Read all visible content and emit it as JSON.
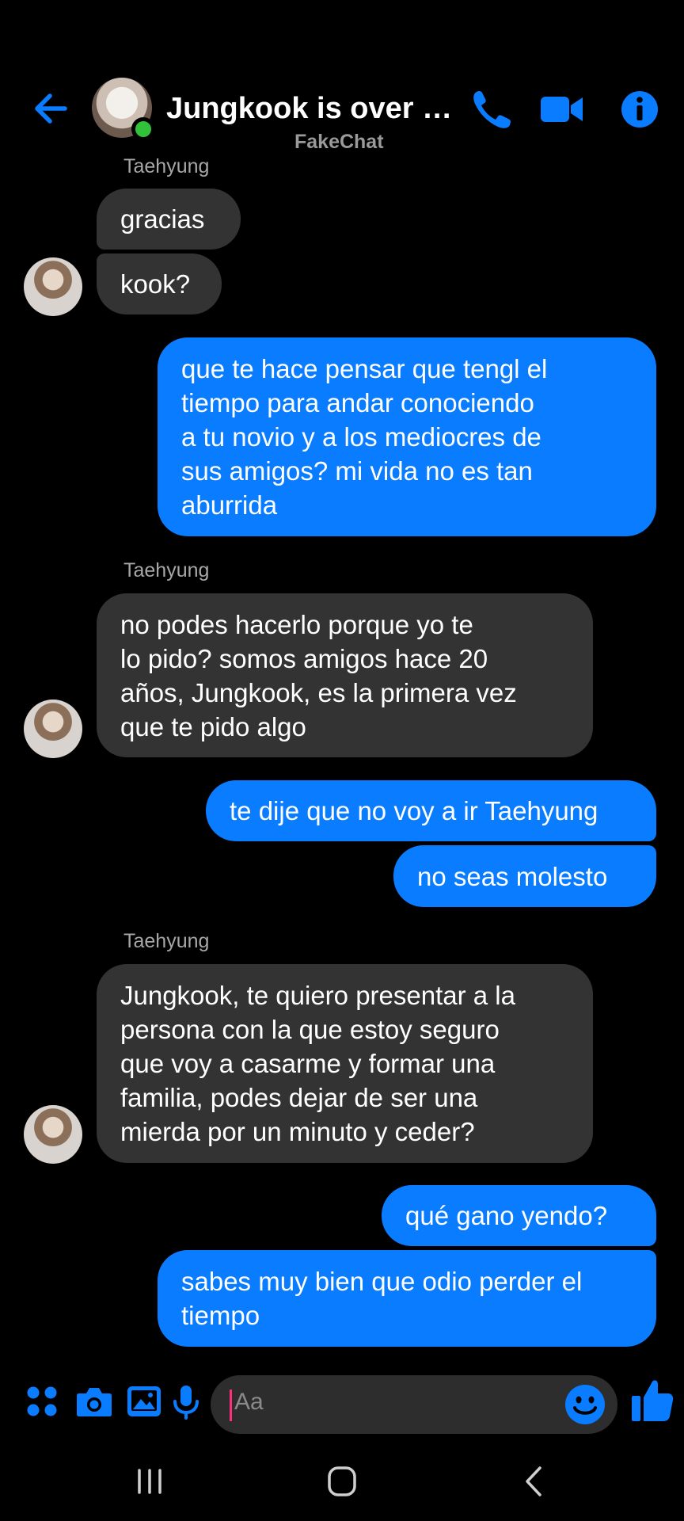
{
  "header": {
    "contact_name": "Jungkook is over p...",
    "subtitle": "FakeChat",
    "status": "online",
    "accent_color": "#0a7cff"
  },
  "messages": [
    {
      "sender": "Taehyung",
      "direction": "incoming",
      "text": "gracias"
    },
    {
      "sender": "Taehyung",
      "direction": "incoming",
      "text": "kook?"
    },
    {
      "direction": "outgoing",
      "text": "que te hace pensar que tengl el\ntiempo para andar conociendo\na tu novio y a los mediocres de\nsus amigos? mi vida no es tan\naburrida"
    },
    {
      "sender": "Taehyung",
      "direction": "incoming",
      "text": "no podes hacerlo porque yo te\nlo pido? somos amigos hace 20\naños, Jungkook, es la primera vez\nque te pido algo"
    },
    {
      "direction": "outgoing",
      "text": "te dije que no voy a ir Taehyung"
    },
    {
      "direction": "outgoing",
      "text": "no seas molesto"
    },
    {
      "sender": "Taehyung",
      "direction": "incoming",
      "text": "Jungkook, te quiero presentar a la\npersona con la que estoy seguro\nque voy a casarme y formar una\nfamilia, podes dejar de ser una\nmierda por un minuto y ceder?"
    },
    {
      "direction": "outgoing",
      "text": "qué gano yendo?"
    },
    {
      "direction": "outgoing",
      "text": "sabes muy bien que odio perder el\ntiempo"
    }
  ],
  "composer": {
    "placeholder": "Aa",
    "icons": [
      "menu-dots-icon",
      "camera-icon",
      "gallery-icon",
      "microphone-icon",
      "emoji-icon",
      "thumbs-up-icon"
    ]
  },
  "system_nav": {
    "icons": [
      "recent-apps-icon",
      "home-icon",
      "back-icon"
    ]
  }
}
